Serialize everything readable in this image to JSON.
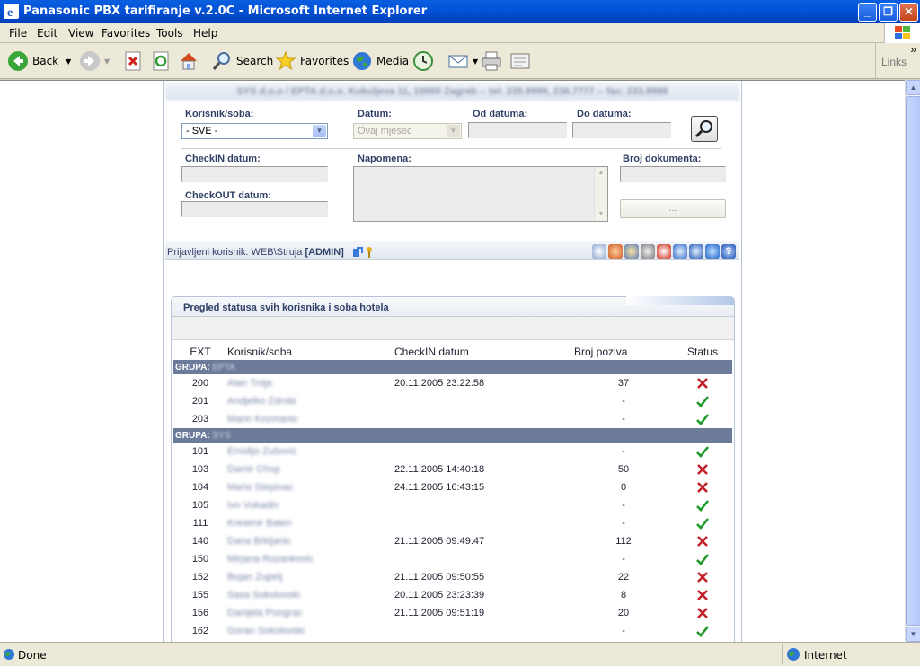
{
  "window": {
    "title": "Panasonic PBX tarifiranje v.2.0C - Microsoft Internet Explorer"
  },
  "menu": [
    "File",
    "Edit",
    "View",
    "Favorites",
    "Tools",
    "Help"
  ],
  "toolbar": {
    "back": "Back",
    "search": "Search",
    "favorites": "Favorites",
    "media": "Media",
    "links": "Links"
  },
  "page": {
    "header": "SYS d.o.o / EPTA d.o.o. Kukuljeva 11, 10000 Zagreb -- tel: 235.9999, 236.7777 -- fax: 233.8888",
    "form": {
      "korisnik_label": "Korisnik/soba:",
      "korisnik_value": "- SVE -",
      "datum_label": "Datum:",
      "datum_value": "Ovaj mjesec",
      "od_label": "Od datuma:",
      "do_label": "Do datuma:",
      "checkin_label": "CheckIN datum:",
      "checkout_label": "CheckOUT datum:",
      "napomena_label": "Napomena:",
      "broj_dok_label": "Broj dokumenta:",
      "dots_label": "..."
    },
    "userbar": {
      "prefix": "Prijavljeni korisnik: WEB\\Struja",
      "role": "[ADMIN]"
    },
    "table": {
      "title": "Pregled statusa svih korisnika i soba hotela",
      "headers": {
        "ext": "EXT",
        "name": "Korisnik/soba",
        "checkin": "CheckIN datum",
        "broj": "Broj poziva",
        "status": "Status"
      },
      "group_prefix": "GRUPA:",
      "groups": [
        {
          "name": "EPTA",
          "rows": [
            {
              "ext": "200",
              "name": "Alan Troja",
              "checkin": "20.11.2005 23:22:58",
              "broj": "37",
              "status": "cross"
            },
            {
              "ext": "201",
              "name": "Andjelko Zdrobi",
              "checkin": "",
              "broj": "-",
              "status": "check"
            },
            {
              "ext": "203",
              "name": "Marin Kozmanic",
              "checkin": "",
              "broj": "-",
              "status": "check"
            }
          ]
        },
        {
          "name": "SYS",
          "rows": [
            {
              "ext": "101",
              "name": "Emidijo Zubovic",
              "checkin": "",
              "broj": "-",
              "status": "check"
            },
            {
              "ext": "103",
              "name": "Damir Chop",
              "checkin": "22.11.2005 14:40:18",
              "broj": "50",
              "status": "cross"
            },
            {
              "ext": "104",
              "name": "Mario Stepinac",
              "checkin": "24.11.2005 16:43:15",
              "broj": "0",
              "status": "cross"
            },
            {
              "ext": "105",
              "name": "Ivo Vukadin",
              "checkin": "",
              "broj": "-",
              "status": "check"
            },
            {
              "ext": "111",
              "name": "Kresimir Balen",
              "checkin": "",
              "broj": "-",
              "status": "check"
            },
            {
              "ext": "140",
              "name": "Dana Brkljanic",
              "checkin": "21.11.2005 09:49:47",
              "broj": "112",
              "status": "cross"
            },
            {
              "ext": "150",
              "name": "Mirjana Rozankovic",
              "checkin": "",
              "broj": "-",
              "status": "check"
            },
            {
              "ext": "152",
              "name": "Bojan Zupelj",
              "checkin": "21.11.2005 09:50:55",
              "broj": "22",
              "status": "cross"
            },
            {
              "ext": "155",
              "name": "Sasa Sokolovski",
              "checkin": "20.11.2005 23:23:39",
              "broj": "8",
              "status": "cross"
            },
            {
              "ext": "156",
              "name": "Danijela Pongrac",
              "checkin": "21.11.2005 09:51:19",
              "broj": "20",
              "status": "cross"
            },
            {
              "ext": "162",
              "name": "Goran Sokolovski",
              "checkin": "",
              "broj": "-",
              "status": "check"
            }
          ]
        }
      ]
    }
  },
  "statusbar": {
    "left": "Done",
    "zone": "Internet"
  },
  "colors": {
    "titlebar": "#0453d8",
    "group_bar": "#6d7b9a",
    "check": "#1f9a2a",
    "cross": "#c0212a",
    "label": "#2f3f66"
  },
  "icons": {
    "titlebar": "ie-logo-icon",
    "status": [
      "check-icon",
      "cross-icon"
    ]
  }
}
